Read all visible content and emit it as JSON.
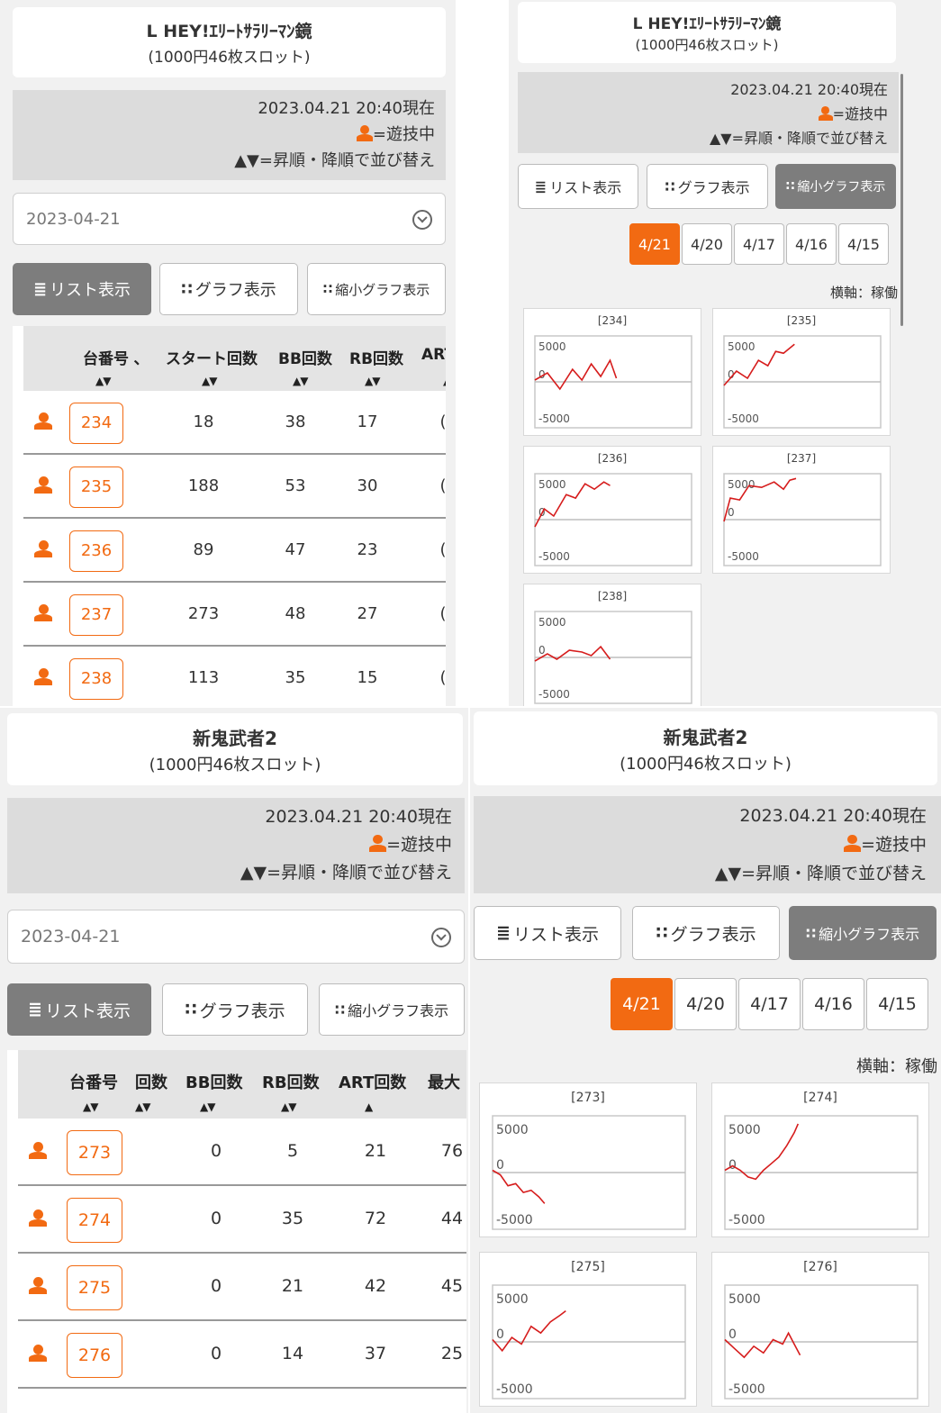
{
  "panels": [
    {
      "id": "q1",
      "title": "L HEY!ｴﾘｰﾄｻﾗﾘｰﾏﾝ鏡",
      "subtitle": "(1000円46枚スロット)",
      "timestamp": "2023.04.21 20:40現在",
      "legend_play": "=遊技中",
      "legend_sort": "▲▼=昇順・降順で並び替え",
      "date_value": "2023-04-21",
      "buttons": [
        "リスト表示",
        "グラフ表示",
        "縮小グラフ表示"
      ],
      "active_button": 0,
      "headers": [
        "台番号 ､",
        "スタート回数",
        "BB回数",
        "RB回数",
        "ART"
      ],
      "sort_marks": [
        "▲▼",
        "▲▼",
        "▲▼",
        "▲▼",
        "▲"
      ],
      "rows": [
        {
          "num": "234",
          "c1": "18",
          "c2": "38",
          "c3": "17",
          "c4": "("
        },
        {
          "num": "235",
          "c1": "188",
          "c2": "53",
          "c3": "30",
          "c4": "("
        },
        {
          "num": "236",
          "c1": "89",
          "c2": "47",
          "c3": "23",
          "c4": "("
        },
        {
          "num": "237",
          "c1": "273",
          "c2": "48",
          "c3": "27",
          "c4": "("
        },
        {
          "num": "238",
          "c1": "113",
          "c2": "35",
          "c3": "15",
          "c4": "("
        }
      ]
    },
    {
      "id": "q2",
      "title": "L HEY!ｴﾘｰﾄｻﾗﾘｰﾏﾝ鏡",
      "subtitle": "(1000円46枚スロット)",
      "timestamp": "2023.04.21 20:40現在",
      "legend_play": "=遊技中",
      "legend_sort": "▲▼=昇順・降順で並び替え",
      "buttons": [
        "リスト表示",
        "グラフ表示",
        "縮小グラフ表示"
      ],
      "active_button": 2,
      "tabs": [
        "4/21",
        "4/20",
        "4/17",
        "4/16",
        "4/15"
      ],
      "active_tab": 0,
      "axis_label": "横軸：稼働",
      "y_labels": [
        "5000",
        "0",
        "-5000"
      ],
      "charts": [
        {
          "label": "[234]",
          "points": [
            [
              0,
              0.05
            ],
            [
              0.08,
              0.25
            ],
            [
              0.16,
              -0.2
            ],
            [
              0.24,
              0.35
            ],
            [
              0.3,
              0.05
            ],
            [
              0.36,
              0.5
            ],
            [
              0.42,
              0.15
            ],
            [
              0.48,
              0.6
            ],
            [
              0.52,
              0.1
            ]
          ]
        },
        {
          "label": "[235]",
          "points": [
            [
              0,
              -0.1
            ],
            [
              0.08,
              0.3
            ],
            [
              0.15,
              0.1
            ],
            [
              0.22,
              0.6
            ],
            [
              0.28,
              0.45
            ],
            [
              0.33,
              0.85
            ],
            [
              0.38,
              0.8
            ],
            [
              0.45,
              1.05
            ]
          ]
        },
        {
          "label": "[236]",
          "points": [
            [
              0,
              -0.2
            ],
            [
              0.06,
              0.3
            ],
            [
              0.12,
              0.1
            ],
            [
              0.2,
              0.7
            ],
            [
              0.26,
              0.6
            ],
            [
              0.32,
              1.0
            ],
            [
              0.38,
              0.85
            ],
            [
              0.44,
              1.05
            ],
            [
              0.48,
              0.95
            ]
          ]
        },
        {
          "label": "[237]",
          "points": [
            [
              0,
              -0.05
            ],
            [
              0.04,
              0.6
            ],
            [
              0.1,
              0.55
            ],
            [
              0.16,
              0.95
            ],
            [
              0.24,
              0.9
            ],
            [
              0.32,
              1.05
            ],
            [
              0.38,
              0.85
            ],
            [
              0.42,
              1.1
            ],
            [
              0.46,
              1.15
            ]
          ]
        },
        {
          "label": "[238]",
          "points": [
            [
              0,
              -0.1
            ],
            [
              0.08,
              0.1
            ],
            [
              0.14,
              -0.05
            ],
            [
              0.22,
              0.2
            ],
            [
              0.3,
              0.15
            ],
            [
              0.36,
              0.05
            ],
            [
              0.42,
              0.3
            ],
            [
              0.48,
              -0.05
            ]
          ]
        }
      ]
    },
    {
      "id": "q3",
      "title": "新鬼武者2",
      "subtitle": "(1000円46枚スロット)",
      "timestamp": "2023.04.21 20:40現在",
      "legend_play": "=遊技中",
      "legend_sort": "▲▼=昇順・降順で並び替え",
      "date_value": "2023-04-21",
      "buttons": [
        "リスト表示",
        "グラフ表示",
        "縮小グラフ表示"
      ],
      "active_button": 0,
      "headers": [
        "台番号",
        "回数",
        "BB回数",
        "RB回数",
        "ART回数",
        "最大"
      ],
      "sort_marks": [
        "▲▼",
        "▲▼",
        "▲▼",
        "▲▼",
        "▲"
      ],
      "rows": [
        {
          "num": "273",
          "c1": "0",
          "c2": "5",
          "c3": "21",
          "c4": "76"
        },
        {
          "num": "274",
          "c1": "0",
          "c2": "35",
          "c3": "72",
          "c4": "44"
        },
        {
          "num": "275",
          "c1": "0",
          "c2": "21",
          "c3": "42",
          "c4": "45"
        },
        {
          "num": "276",
          "c1": "0",
          "c2": "14",
          "c3": "37",
          "c4": "25"
        }
      ]
    },
    {
      "id": "q4",
      "title": "新鬼武者2",
      "subtitle": "(1000円46枚スロット)",
      "timestamp": "2023.04.21 20:40現在",
      "legend_play": "=遊技中",
      "legend_sort": "▲▼=昇順・降順で並び替え",
      "buttons": [
        "リスト表示",
        "グラフ表示",
        "縮小グラフ表示"
      ],
      "active_button": 2,
      "tabs": [
        "4/21",
        "4/20",
        "4/17",
        "4/16",
        "4/15"
      ],
      "active_tab": 0,
      "axis_label": "横軸：稼働",
      "y_labels": [
        "5000",
        "0",
        "-5000"
      ],
      "charts": [
        {
          "label": "[273]",
          "points": [
            [
              0,
              0.05
            ],
            [
              0.04,
              -0.05
            ],
            [
              0.08,
              -0.3
            ],
            [
              0.12,
              -0.25
            ],
            [
              0.16,
              -0.45
            ],
            [
              0.2,
              -0.4
            ],
            [
              0.24,
              -0.55
            ],
            [
              0.27,
              -0.7
            ]
          ]
        },
        {
          "label": "[274]",
          "points": [
            [
              0,
              0.05
            ],
            [
              0.04,
              0.15
            ],
            [
              0.08,
              0.05
            ],
            [
              0.12,
              -0.1
            ],
            [
              0.16,
              -0.15
            ],
            [
              0.2,
              0.05
            ],
            [
              0.24,
              0.2
            ],
            [
              0.28,
              0.35
            ],
            [
              0.32,
              0.6
            ],
            [
              0.36,
              0.9
            ],
            [
              0.38,
              1.1
            ]
          ]
        },
        {
          "label": "[275]",
          "points": [
            [
              0,
              0.05
            ],
            [
              0.05,
              -0.2
            ],
            [
              0.1,
              0.1
            ],
            [
              0.15,
              -0.05
            ],
            [
              0.2,
              0.35
            ],
            [
              0.25,
              0.2
            ],
            [
              0.3,
              0.45
            ],
            [
              0.35,
              0.6
            ],
            [
              0.38,
              0.7
            ]
          ]
        },
        {
          "label": "[276]",
          "points": [
            [
              0,
              0.05
            ],
            [
              0.05,
              -0.15
            ],
            [
              0.1,
              -0.35
            ],
            [
              0.15,
              -0.1
            ],
            [
              0.2,
              -0.25
            ],
            [
              0.25,
              0.05
            ],
            [
              0.3,
              -0.05
            ],
            [
              0.33,
              0.2
            ],
            [
              0.36,
              -0.05
            ],
            [
              0.39,
              -0.3
            ]
          ]
        }
      ]
    }
  ]
}
